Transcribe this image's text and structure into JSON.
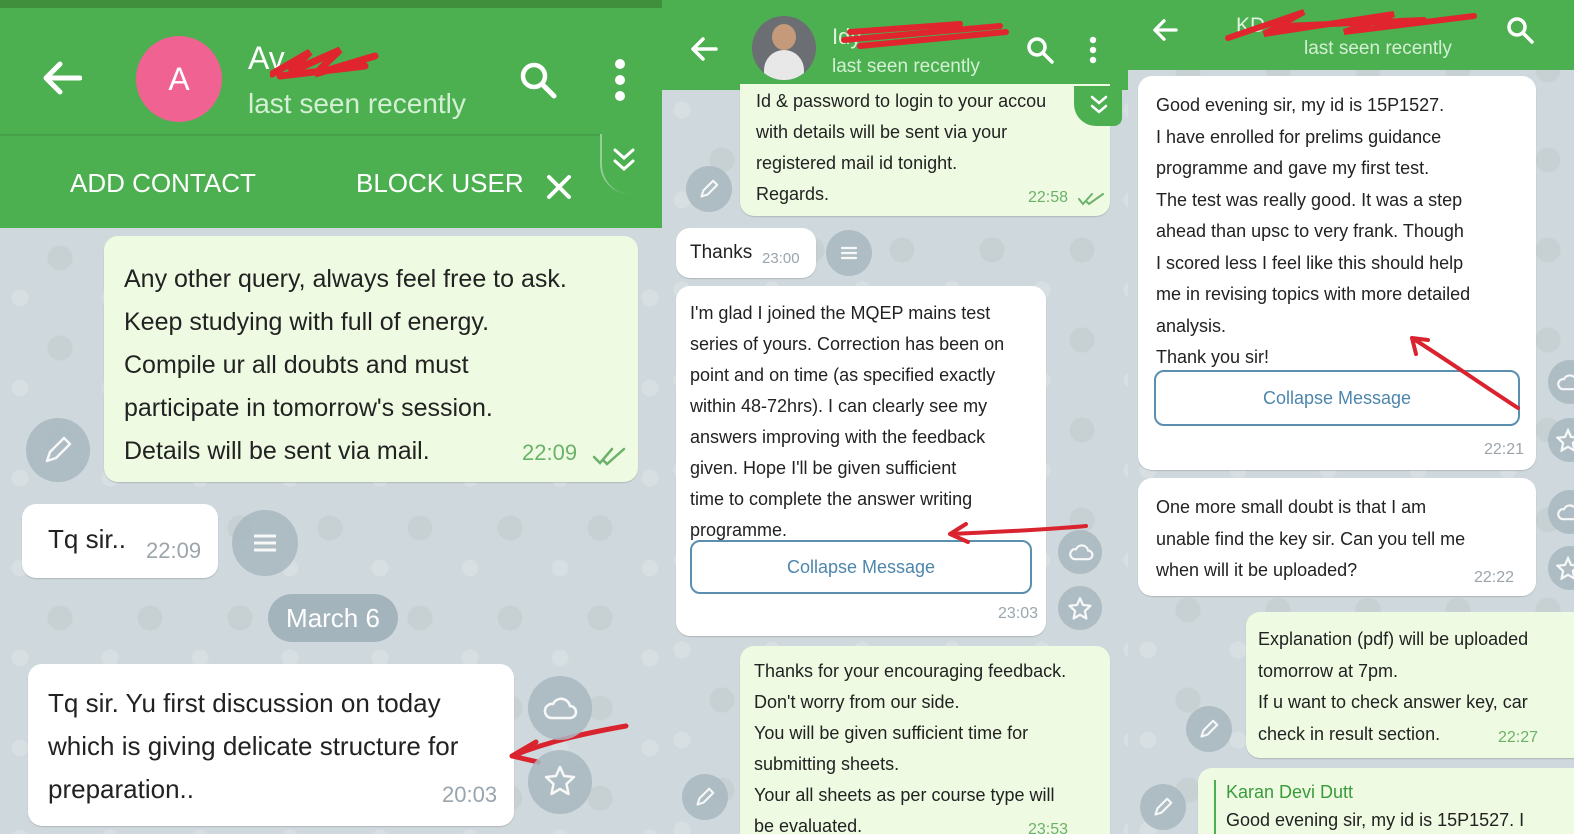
{
  "panel1": {
    "header": {
      "avatar_letter": "A",
      "name": "Av",
      "status": "last seen recently",
      "add_contact": "ADD CONTACT",
      "block_user": "BLOCK USER"
    },
    "messages": [
      {
        "lines": [
          "Any other query, always feel free to ask.",
          "Keep studying with full of energy.",
          "Compile ur all doubts and must",
          "participate in tomorrow's session.",
          "Details will be sent via mail."
        ],
        "time": "22:09"
      },
      {
        "lines": [
          "Tq sir.."
        ],
        "time": "22:09"
      },
      {
        "lines": [
          "Tq sir. Yu first discussion on today",
          "which is giving delicate structure for",
          "preparation.."
        ],
        "time": "20:03"
      }
    ],
    "date_chip": "March 6"
  },
  "panel2": {
    "header": {
      "name": "Idy",
      "status": "last seen recently"
    },
    "messages": [
      {
        "lines": [
          "Id & password to login to your accou",
          "with details will be sent via your",
          "registered mail id tonight.",
          "Regards."
        ],
        "time": "22:58"
      },
      {
        "lines": [
          "Thanks"
        ],
        "time": "23:00"
      },
      {
        "lines": [
          "I'm glad I joined the MQEP mains test",
          "series of yours. Correction has been on",
          "point and on time (as specified exactly",
          "within 48-72hrs). I can clearly see my",
          "answers improving with the feedback",
          "given. Hope I'll be given sufficient",
          "time to complete the answer writing",
          "programme."
        ],
        "collapse": "Collapse Message",
        "time": "23:03"
      },
      {
        "lines": [
          "Thanks for your encouraging feedback.",
          "Don't worry from our side.",
          "You will be given sufficient time for",
          "submitting sheets.",
          "Your all sheets as per course type will",
          "be evaluated."
        ],
        "time": "23:53"
      }
    ]
  },
  "panel3": {
    "header": {
      "name": "KD",
      "status": "last seen recently"
    },
    "messages": [
      {
        "lines": [
          "Good evening sir, my id is 15P1527.",
          "I have enrolled for prelims guidance",
          "programme and gave my first test.",
          "The test was really good. It was a step",
          "ahead than upsc to very frank. Though",
          "I scored less I feel like this should help",
          "me in revising topics with more detailed",
          "analysis.",
          "Thank you sir!"
        ],
        "collapse": "Collapse Message",
        "time": "22:21"
      },
      {
        "lines": [
          "One more small doubt is that I am",
          "unable find the key sir. Can you tell me",
          "when will it be uploaded?"
        ],
        "time": "22:22"
      },
      {
        "lines": [
          "Explanation (pdf) will be uploaded",
          "tomorrow at 7pm.",
          "If u want to check answer key, car",
          "check in result section."
        ],
        "time": "22:27"
      },
      {
        "reply_name": "Karan Devi Dutt",
        "reply_text": "Good evening sir, my id is 15P1527. I"
      }
    ]
  },
  "colors": {
    "header_green": "#4caf50",
    "outgoing_bubble": "#eefbe2",
    "annotation_red": "#d9232f",
    "avatar_pink": "#f06292"
  }
}
